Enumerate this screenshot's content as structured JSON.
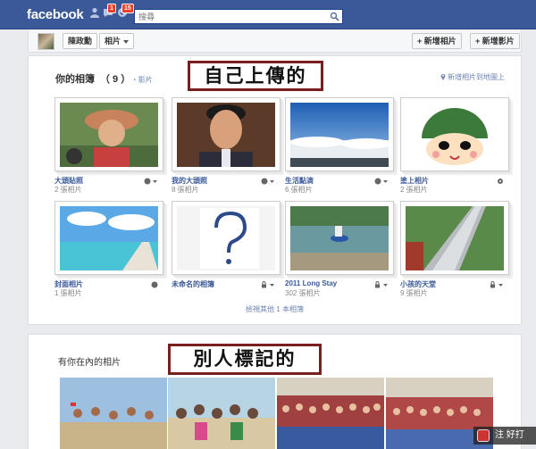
{
  "topbar": {
    "logo": "facebook",
    "badges": [
      "1",
      "15"
    ],
    "search_placeholder": "搜尋"
  },
  "header": {
    "user_name": "陳政勳",
    "photos_menu": "相片",
    "add_photos": "+ 新增相片",
    "add_video": "+ 新增影片"
  },
  "annotations": {
    "own_uploads": "自己上傳的",
    "tagged_by_others": "別人標記的"
  },
  "albums_section": {
    "title": "你的相簿",
    "count": "（ 9 ）",
    "video_link": "・影片",
    "map_link": "新增相片到地圖上",
    "more_link": "檢視其他 1 本相簿"
  },
  "albums": [
    {
      "name": "大頭貼照",
      "count": "2 張相片",
      "privacy": "public",
      "scene": "man-hat"
    },
    {
      "name": "我的大頭照",
      "count": "8 張相片",
      "privacy": "public",
      "scene": "man-portrait"
    },
    {
      "name": "生活點滴",
      "count": "6 張相片",
      "privacy": "public",
      "scene": "sea-clouds"
    },
    {
      "name": "塗上相片",
      "count": "2 張相片",
      "privacy": "gear",
      "scene": "cartoon-helmet"
    },
    {
      "name": "封面相片",
      "count": "1 張相片",
      "privacy": "public",
      "scene": "pier-beach"
    },
    {
      "name": "未命名的相簿",
      "count": "",
      "privacy": "lock",
      "scene": "question-mark"
    },
    {
      "name": "2011 Long Stay",
      "count": "302 張相片",
      "privacy": "lock",
      "scene": "river-rock"
    },
    {
      "name": "小孩的天堂",
      "count": "9 張相片",
      "privacy": "lock",
      "scene": "slide"
    }
  ],
  "tagged_section": {
    "title": "有你在內的相片"
  },
  "watermark": {
    "text": "注 好打"
  },
  "colors": {
    "brand": "#3b5998",
    "link": "#3b5998",
    "label_border": "#7a1f1f",
    "badge": "#f03d25"
  }
}
